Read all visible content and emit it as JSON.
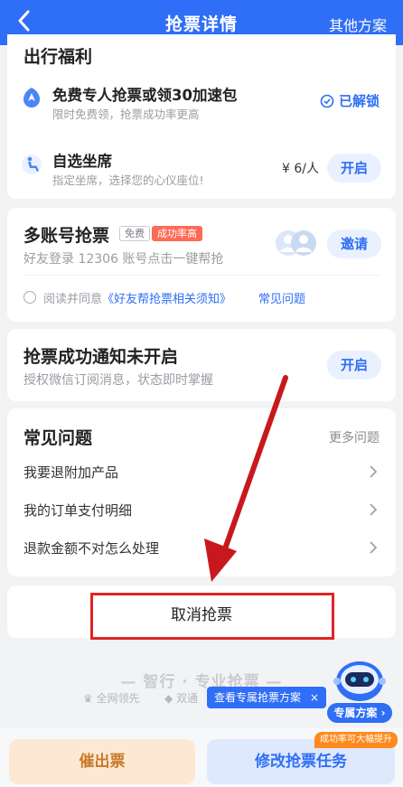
{
  "header": {
    "title": "抢票详情",
    "other_plan": "其他方案"
  },
  "welfare": {
    "title": "出行福利",
    "speed": {
      "title": "免费专人抢票或领30加速包",
      "sub": "限时免费领，抢票成功率更高",
      "status": "已解锁"
    },
    "seat": {
      "title": "自选坐席",
      "sub": "指定坐席，选择您的心仪座位!",
      "price": "¥ 6/人",
      "button": "开启"
    }
  },
  "multi": {
    "title": "多账号抢票",
    "tag_free": "免费",
    "tag_rate": "成功率高",
    "sub": "好友登录 12306 账号点击一键帮抢",
    "button": "邀请",
    "agree_prefix": "阅读并同意",
    "agree_link": "《好友帮抢票相关须知》",
    "faq_link": "常见问题"
  },
  "notify": {
    "title": "抢票成功通知未开启",
    "sub": "授权微信订阅消息，状态即时掌握",
    "button": "开启"
  },
  "faq": {
    "title": "常见问题",
    "more": "更多问题",
    "items": [
      "我要退附加产品",
      "我的订单支付明细",
      "退款金额不对怎么处理"
    ]
  },
  "cancel": {
    "label": "取消抢票"
  },
  "slogan": {
    "main": "— 智行 · 专业抢票 —",
    "left": "全网领先",
    "right": "双通"
  },
  "float": {
    "tip": "查看专属抢票方案",
    "close": "×",
    "assistant": "专属方案"
  },
  "bottom": {
    "urge": "催出票",
    "modify": "修改抢票任务",
    "badge": "成功率可大幅提升"
  },
  "colors": {
    "primary": "#2f6ef6",
    "danger": "#e02424",
    "accent_orange": "#ff8a1e"
  }
}
